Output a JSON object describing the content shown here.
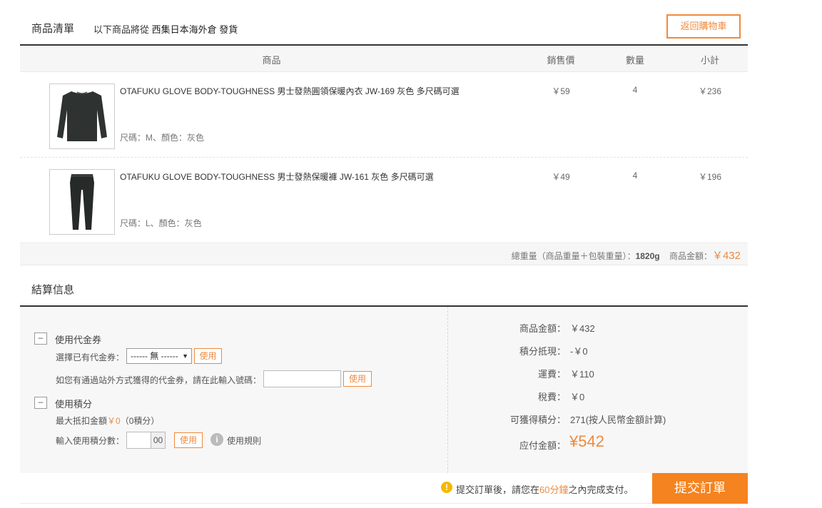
{
  "header": {
    "title": "商品清單",
    "ship_prefix": "以下商品將從",
    "warehouse": "西集日本海外倉 發貨",
    "back_button": "返回購物車"
  },
  "table": {
    "columns": [
      "商品",
      "銷售價",
      "數量",
      "小計"
    ],
    "rows": [
      {
        "name": "OTAFUKU GLOVE BODY-TOUGHNESS 男士發熱圓領保暖內衣 JW-169 灰色 多尺碼可選",
        "spec": "尺碼：M、顏色：灰色",
        "price": "￥59",
        "qty": "4",
        "subtotal": "￥236",
        "thumb_icon": "long-sleeve-shirt-image"
      },
      {
        "name": "OTAFUKU GLOVE BODY-TOUGHNESS 男士發熱保暖褲 JW-161 灰色 多尺碼可選",
        "spec": "尺碼：L、顏色：灰色",
        "price": "￥49",
        "qty": "4",
        "subtotal": "￥196",
        "thumb_icon": "leggings-image"
      }
    ]
  },
  "summary": {
    "weight_label": "總重量（商品重量＋包裝重量）：",
    "weight": "1820g",
    "amount_label": "商品金額：",
    "amount": "￥432"
  },
  "settlement": {
    "title": "結算信息",
    "coupon": {
      "toggle": "–",
      "label": "使用代金券",
      "select_label": "選擇已有代金券：",
      "select_value": "------ 無 ------",
      "use_button": "使用",
      "code_label": "如您有通過站外方式獲得的代金券，請在此輸入號碼：",
      "code_placeholder": "",
      "code_button": "使用"
    },
    "points": {
      "toggle": "–",
      "label": "使用積分",
      "max_prefix": "最大抵扣金額",
      "max_amount": "￥0",
      "max_suffix": "（0積分）",
      "input_label": "輸入使用積分數：",
      "input_suffix": "00",
      "use_button": "使用",
      "rules_label": "使用規則"
    },
    "right": {
      "goods_label": "商品金額：",
      "goods_value": "￥432",
      "points_label": "積分抵現：",
      "points_value": "-￥0",
      "shipping_label": "運費：",
      "shipping_value": "￥110",
      "tax_label": "稅費：",
      "tax_value": "￥0",
      "earn_label": "可獲得積分：",
      "earn_value": "271(按人民幣金額計算)",
      "total_label": "应付金額：",
      "total_value": "¥542"
    }
  },
  "submit": {
    "notice_before": "提交訂單後，請您在",
    "notice_time": "60分鐘",
    "notice_after": "之內完成支付。",
    "button": "提交訂單"
  },
  "colors": {
    "accent": "#f08a3c",
    "submit_bg": "#f5831f",
    "warn": "#f5b800"
  }
}
